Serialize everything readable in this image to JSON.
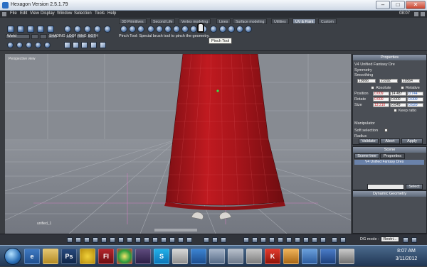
{
  "window": {
    "title": "Hexagon Version 2.5.1.79",
    "min": "–",
    "max": "□",
    "close": "✕"
  },
  "menu": [
    "File",
    "Edit",
    "View",
    "Display",
    "Window",
    "Selection",
    "Tools",
    "Help"
  ],
  "clock_top": "08:07",
  "tabs": [
    "3D Primitives",
    "Second Life",
    "Vertex modeling",
    "Lines",
    "Surface modeling",
    "Utilities",
    "UV & Paint",
    "Custom"
  ],
  "active_tab": "UV & Paint",
  "toolbar_left": {
    "world": "World",
    "loop": "LOOP",
    "ring": "RING",
    "both": "BOTH",
    "shading": "SHADING"
  },
  "hint": "Pinch Tool: Special brush tool to pinch the geometry.",
  "tooltip": "Pinch Tool",
  "viewport": {
    "label": "Perspective view",
    "object_label": "unified_1"
  },
  "properties": {
    "title": "Properties",
    "object_name": "V4 Unified Fantasy Dre",
    "symmetry": "Symmetry",
    "smoothing": "Smoothing",
    "counts": [
      "10666",
      "21092",
      "10564"
    ],
    "absolute": "Absolute",
    "relative": "Relative",
    "position_label": "Position",
    "position": [
      "0.009",
      "14.487",
      "0.744"
    ],
    "rotate_label": "Rotate",
    "rotate": [
      "0.000",
      "0.000",
      "0.000"
    ],
    "size_label": "Size",
    "size": [
      "13.210",
      "0.549",
      "0.620"
    ],
    "keep_ratio": "Keep ratio",
    "manipulator": "Manipulator",
    "soft_selection": "Soft selection",
    "radius": "Radius",
    "validate": "Validate",
    "abort": "Abort",
    "apply": "Apply"
  },
  "scene": {
    "title": "Scene",
    "tab_tree": "Scene tree",
    "tab_props": "Properties",
    "item": "V4 Unified Fantasy Dres",
    "select": "Select"
  },
  "dynamic_geometry": {
    "title": "Dynamic Geometry",
    "mode_label": "DG mode :",
    "mode_value": "Restri..."
  },
  "taskbar": {
    "time": "8:07 AM",
    "date": "3/11/2012",
    "ps": "Ps",
    "fl": "Fl",
    "s": "S",
    "k": "K"
  },
  "colors": {
    "accent": "#7e8a9c",
    "dress": "#b0161c",
    "panel": "#4a4e55"
  }
}
